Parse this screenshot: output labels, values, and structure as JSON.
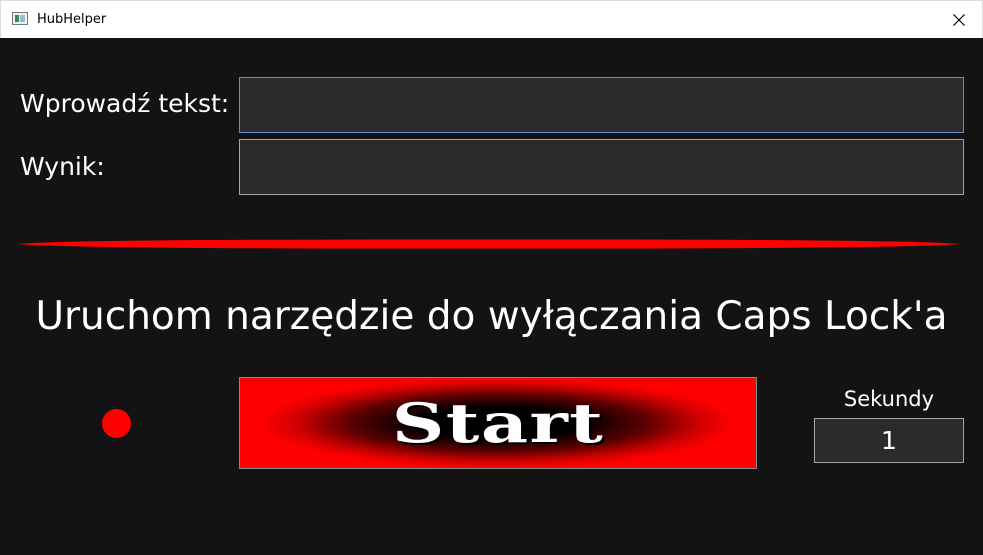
{
  "window": {
    "title": "HubHelper",
    "icon": "app-window-icon",
    "close_icon": "close-icon"
  },
  "form": {
    "input_label": "Wprowadź tekst:",
    "input_value": "",
    "result_label": "Wynik:",
    "result_value": ""
  },
  "divider_color": "#ff0000",
  "capslock_tool": {
    "heading": "Uruchom narzędzie do wyłączania Caps Lock'a",
    "status_color": "#ff0000",
    "start_label": "Start",
    "seconds_label": "Sekundy",
    "seconds_value": "1"
  },
  "colors": {
    "background": "#131313",
    "field_background": "#2d2a2a",
    "accent": "#ff0000",
    "focus_border": "#5b8fd6"
  }
}
